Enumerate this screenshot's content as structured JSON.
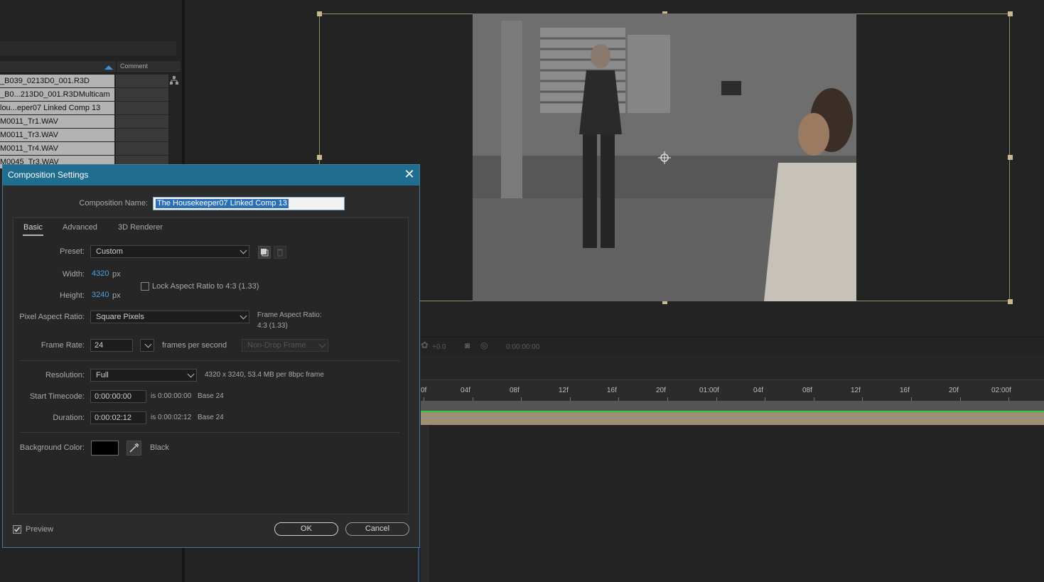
{
  "project_panel": {
    "column_comment": "Comment",
    "items": [
      "_B039_0213D0_001.R3D",
      "_B0...213D0_001.R3DMulticam",
      "lou...eper07 Linked Comp 13",
      "M0011_Tr1.WAV",
      "M0011_Tr3.WAV",
      "M0011_Tr4.WAV",
      "M0045_Tr3.WAV"
    ]
  },
  "viewer_toolbar": {
    "exposure": "+0.0",
    "timecode": "0:00:00:00"
  },
  "timeline": {
    "ruler_labels": [
      "0f",
      "04f",
      "08f",
      "12f",
      "16f",
      "20f",
      "01:00f",
      "04f",
      "08f",
      "12f",
      "16f",
      "20f",
      "02:00f"
    ]
  },
  "dialog": {
    "title": "Composition Settings",
    "comp_name_label": "Composition Name:",
    "comp_name_value": "The Housekeeper07 Linked Comp 13",
    "tabs": [
      "Basic",
      "Advanced",
      "3D Renderer"
    ],
    "preset_label": "Preset:",
    "preset_value": "Custom",
    "width_label": "Width:",
    "width_value": "4320",
    "height_label": "Height:",
    "height_value": "3240",
    "px_unit": "px",
    "lock_aspect_label": "Lock Aspect Ratio to 4:3 (1.33)",
    "par_label": "Pixel Aspect Ratio:",
    "par_value": "Square Pixels",
    "frame_aspect_label": "Frame Aspect Ratio:",
    "frame_aspect_value": "4:3 (1.33)",
    "frame_rate_label": "Frame Rate:",
    "frame_rate_value": "24",
    "fps_label": "frames per second",
    "drop_frame_value": "Non-Drop Frame",
    "resolution_label": "Resolution:",
    "resolution_value": "Full",
    "resolution_info": "4320 x 3240, 53.4 MB per 8bpc frame",
    "start_tc_label": "Start Timecode:",
    "start_tc_value": "0:00:00:00",
    "start_tc_info": "is 0:00:00:00",
    "start_tc_base": "Base 24",
    "duration_label": "Duration:",
    "duration_value": "0:00:02:12",
    "duration_info": "is 0:00:02:12",
    "duration_base": "Base 24",
    "bg_color_label": "Background Color:",
    "bg_color_name": "Black",
    "bg_color_hex": "#000000",
    "preview_label": "Preview",
    "ok_label": "OK",
    "cancel_label": "Cancel",
    "close_glyph": "✕"
  }
}
